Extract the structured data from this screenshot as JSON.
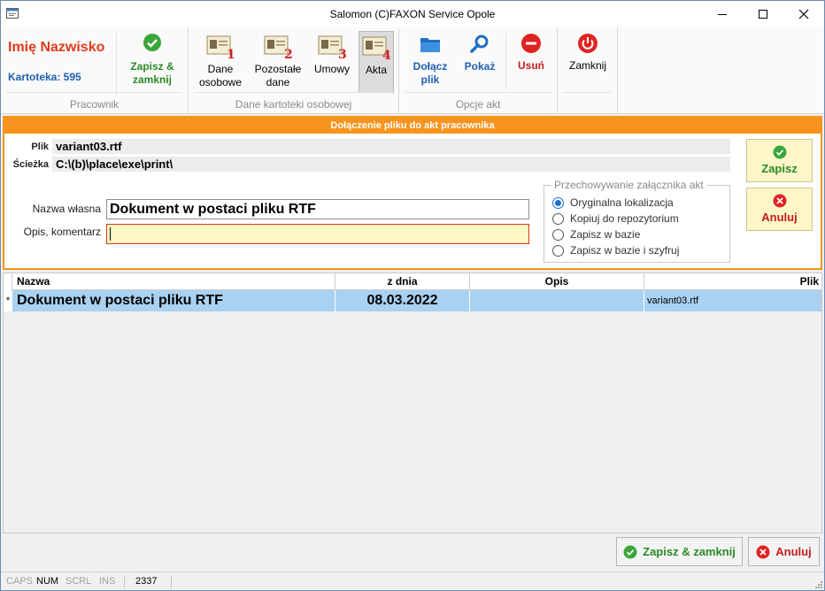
{
  "window": {
    "title": "Salomon (C)FAXON Service Opole"
  },
  "ribbon": {
    "employee_name": "Imię Nazwisko",
    "card_number": "Kartoteka: 595",
    "save_close_line1": "Zapisz &",
    "save_close_line2": "zamknij",
    "group_employee": "Pracownik",
    "personal_line1": "Dane",
    "personal_line2": "osobowe",
    "other_line1": "Pozostałe",
    "other_line2": "dane",
    "contracts": "Umowy",
    "records": "Akta",
    "group_records": "Dane kartoteki osobowej",
    "attach_line1": "Dołącz",
    "attach_line2": "plik",
    "show": "Pokaż",
    "delete": "Usuń",
    "group_options": "Opcje akt",
    "close": "Zamknij",
    "badge_1": "1",
    "badge_2": "2",
    "badge_3": "3",
    "badge_4": "4"
  },
  "form": {
    "header": "Dołączenie pliku do akt pracownika",
    "file_label": "Plik",
    "file_value": "variant03.rtf",
    "path_label": "Ścieżka",
    "path_value": "C:\\(b)\\place\\exe\\print\\",
    "own_name_label": "Nazwa własna",
    "own_name_value": "Dokument w postaci pliku RTF",
    "comment_label": "Opis, komentarz",
    "comment_value": "",
    "storage_legend": "Przechowywanie załącznika akt",
    "storage_options": [
      "Oryginalna lokalizacja",
      "Kopiuj do repozytorium",
      "Zapisz w bazie",
      "Zapisz w bazie i szyfruj"
    ],
    "selected_option": 0,
    "save": "Zapisz",
    "cancel": "Anuluj"
  },
  "grid": {
    "columns": [
      "Nazwa",
      "z dnia",
      "Opis",
      "Plik"
    ],
    "rows": [
      {
        "marker": "*",
        "name": "Dokument w postaci pliku RTF",
        "date": "08.03.2022",
        "desc": "",
        "file": "variant03.rtf"
      }
    ]
  },
  "footer": {
    "save_close": "Zapisz & zamknij",
    "cancel": "Anuluj"
  },
  "statusbar": {
    "caps": "CAPS",
    "num": "NUM",
    "scrl": "SCRL",
    "ins": "INS",
    "count": "2337"
  },
  "colors": {
    "accent_orange": "#f7941d",
    "green": "#2a8a2a",
    "red": "#c41d1d",
    "blue": "#1f5fb0",
    "selection": "#a9d1f1"
  }
}
